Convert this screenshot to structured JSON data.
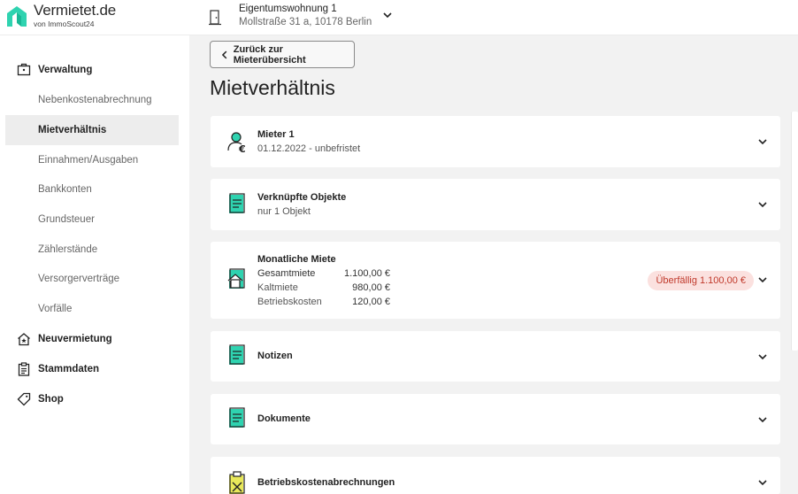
{
  "brand": {
    "title": "Vermietet.de",
    "subtitle": "von ImmoScout24"
  },
  "property": {
    "title": "Eigentumswohnung 1",
    "address": "Mollstraße 31 a, 10178 Berlin"
  },
  "sidebar": {
    "sections": [
      {
        "label": "Verwaltung",
        "icon": "briefcase-icon"
      },
      {
        "label": "Neuvermietung",
        "icon": "house-star-icon"
      },
      {
        "label": "Stammdaten",
        "icon": "clipboard-icon"
      },
      {
        "label": "Shop",
        "icon": "tag-icon"
      }
    ],
    "items": [
      {
        "label": "Nebenkostenabrechnung"
      },
      {
        "label": "Mietverhältnis",
        "active": true
      },
      {
        "label": "Einnahmen/Ausgaben"
      },
      {
        "label": "Bankkonten"
      },
      {
        "label": "Grundsteuer"
      },
      {
        "label": "Zählerstände"
      },
      {
        "label": "Versorgerverträge"
      },
      {
        "label": "Vorfälle"
      }
    ]
  },
  "main": {
    "back_label": "Zurück zur Mieterübersicht",
    "title": "Mietverhältnis",
    "cards": {
      "tenant": {
        "title": "Mieter 1",
        "subtitle": "01.12.2022 - unbefristet"
      },
      "objects": {
        "title": "Verknüpfte Objekte",
        "subtitle": "nur 1 Objekt"
      },
      "rent": {
        "title": "Monatliche Miete",
        "rows": [
          {
            "label": "Gesamtmiete",
            "value": "1.100,00 €"
          },
          {
            "label": "Kaltmiete",
            "value": "980,00 €"
          },
          {
            "label": "Betriebskosten",
            "value": "120,00 €"
          }
        ],
        "badge": "Überfällig 1.100,00 €"
      },
      "notes": {
        "title": "Notizen"
      },
      "documents": {
        "title": "Dokumente"
      },
      "statements": {
        "title": "Betriebskostenabrechnungen"
      }
    }
  },
  "colors": {
    "accent": "#2fd3b0",
    "overdue_bg": "#fbe1df",
    "overdue_text": "#c0392b"
  }
}
